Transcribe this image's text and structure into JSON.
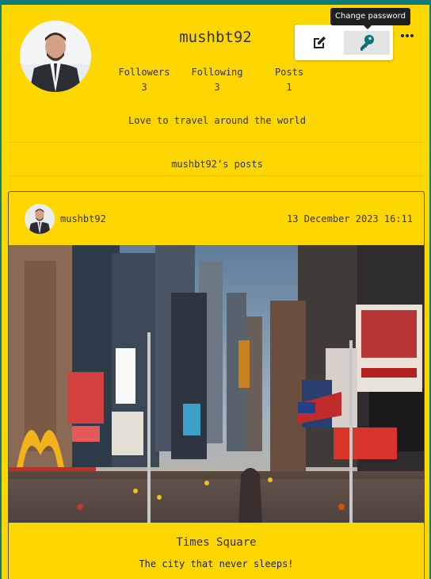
{
  "profile": {
    "username": "mushbt92",
    "avatar_alt": "profile photo",
    "stats": [
      {
        "label": "Followers",
        "value": "3"
      },
      {
        "label": "Following",
        "value": "3"
      },
      {
        "label": "Posts",
        "value": "1"
      }
    ],
    "bio": "Love to travel around the world"
  },
  "actions": {
    "edit_icon": "edit-icon",
    "key_icon": "key-icon",
    "more_icon": "more-dots-icon",
    "tooltip": "Change password"
  },
  "posts_section": {
    "heading": "mushbt92‘s posts"
  },
  "post": {
    "username": "mushbt92",
    "date": "13 December 2023 16:11",
    "image_alt": "Times Square city street",
    "title": "Times Square",
    "description": "The city that never sleeps!"
  },
  "colors": {
    "background": "#ffd700",
    "accent": "#0f7a77",
    "key_icon": "#0d7377"
  }
}
